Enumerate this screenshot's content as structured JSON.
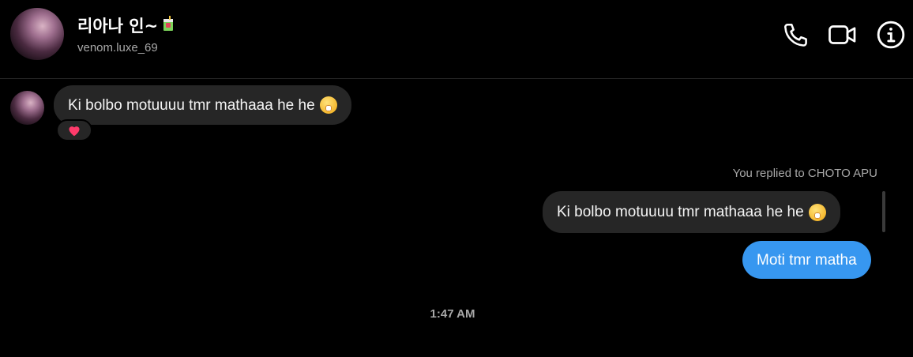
{
  "header": {
    "name": "리아나 인~",
    "username": "venom.luxe_69",
    "icons": [
      "phone-icon",
      "video-icon",
      "info-icon"
    ]
  },
  "messages": [
    {
      "from": "them",
      "text": "Ki bolbo motuuuu tmr mathaaa he he",
      "emoji": "face-with-hand-over-mouth",
      "reaction": "heart"
    },
    {
      "from": "me",
      "reply_note": "You replied to CHOTO APU",
      "quoted_text": "Ki bolbo motuuuu tmr mathaaa he he",
      "text": "Moti tmr matha"
    }
  ],
  "timestamp": "1:47 AM",
  "colors": {
    "background": "#000000",
    "bubble_gray": "#262626",
    "bubble_blue": "#3797f0",
    "muted": "#a8a8a8"
  }
}
